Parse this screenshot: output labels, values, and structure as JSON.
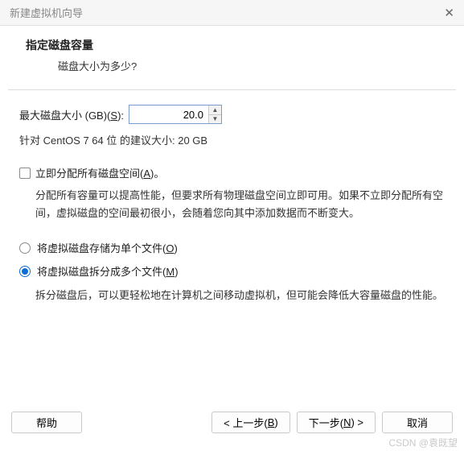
{
  "window": {
    "title": "新建虚拟机向导"
  },
  "header": {
    "title": "指定磁盘容量",
    "subtitle": "磁盘大小为多少?"
  },
  "disk": {
    "label_prefix": "最大磁盘大小 (GB)(",
    "label_hotkey": "S",
    "label_suffix": "):",
    "value": "20.0",
    "recommended": "针对 CentOS 7 64 位 的建议大小: 20 GB"
  },
  "allocate": {
    "label_prefix": "立即分配所有磁盘空间(",
    "label_hotkey": "A",
    "label_suffix": ")。",
    "desc": "分配所有容量可以提高性能，但要求所有物理磁盘空间立即可用。如果不立即分配所有空间，虚拟磁盘的空间最初很小，会随着您向其中添加数据而不断变大。"
  },
  "store": {
    "single_prefix": "将虚拟磁盘存储为单个文件(",
    "single_hotkey": "O",
    "single_suffix": ")",
    "split_prefix": "将虚拟磁盘拆分成多个文件(",
    "split_hotkey": "M",
    "split_suffix": ")",
    "split_desc": "拆分磁盘后，可以更轻松地在计算机之间移动虚拟机，但可能会降低大容量磁盘的性能。"
  },
  "buttons": {
    "help": "帮助",
    "back_prefix": "< 上一步(",
    "back_hotkey": "B",
    "back_suffix": ")",
    "next_prefix": "下一步(",
    "next_hotkey": "N",
    "next_suffix": ") >",
    "cancel": "取消"
  },
  "watermark": "CSDN @袁既望"
}
